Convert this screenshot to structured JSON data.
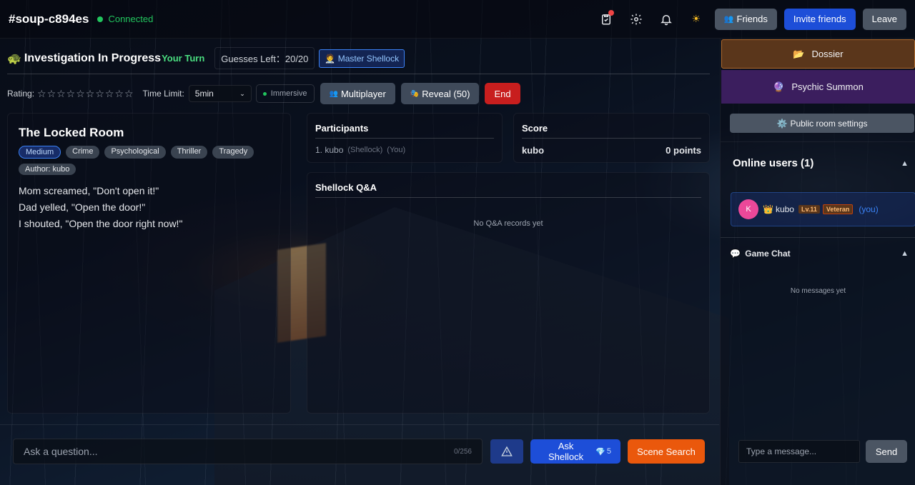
{
  "header": {
    "room_name": "#soup-c894es",
    "connection_status": "Connected",
    "friends_label": "Friends",
    "invite_label": "Invite friends",
    "leave_label": "Leave"
  },
  "status": {
    "title": "Investigation In Progress",
    "turn": "Your Turn",
    "guesses_label": "Guesses Left：20/20",
    "master_label": "Master Shellock"
  },
  "controls": {
    "rating_label": "Rating:",
    "stars": "☆☆☆☆☆☆☆☆☆☆",
    "time_limit_label": "Time Limit:",
    "time_limit_value": "5min",
    "immersive_label": "Immersive",
    "multiplayer_label": "Multiplayer",
    "reveal_label": "Reveal (50)",
    "end_label": "End"
  },
  "story": {
    "title": "The Locked Room",
    "tags": [
      "Medium",
      "Crime",
      "Psychological",
      "Thriller",
      "Tragedy",
      "Author: kubo"
    ],
    "lines": [
      "Mom screamed, \"Don't open it!\"",
      "Dad yelled, \"Open the door!\"",
      "I shouted, \"Open the door right now!\""
    ]
  },
  "participants": {
    "title": "Participants",
    "entry_name": "1. kubo",
    "entry_role": "(Shellock)",
    "entry_you": "(You)"
  },
  "score": {
    "title": "Score",
    "name": "kubo",
    "points": "0 points"
  },
  "qa": {
    "title": "Shellock Q&A",
    "empty": "No Q&A records yet"
  },
  "bottom": {
    "ask_placeholder": "Ask a question...",
    "counter": "0/256",
    "ask_label": "Ask Shellock",
    "ask_cost": "5",
    "scene_label": "Scene Search"
  },
  "sidebar": {
    "dossier_label": "Dossier",
    "psychic_label": "Psychic Summon",
    "room_settings_label": "Public room settings",
    "online_title": "Online users (1)",
    "user": {
      "initial": "K",
      "name": "kubo",
      "level": "Lv.11",
      "badge": "Veteran",
      "you": "(you)"
    },
    "chat_title": "Game Chat",
    "chat_empty": "No messages yet",
    "chat_placeholder": "Type a message...",
    "send_label": "Send"
  },
  "colors": {
    "accent_blue": "#1d4ed8",
    "connected_green": "#22c55e",
    "end_red": "#c81e1e",
    "scene_orange": "#ea580c"
  }
}
